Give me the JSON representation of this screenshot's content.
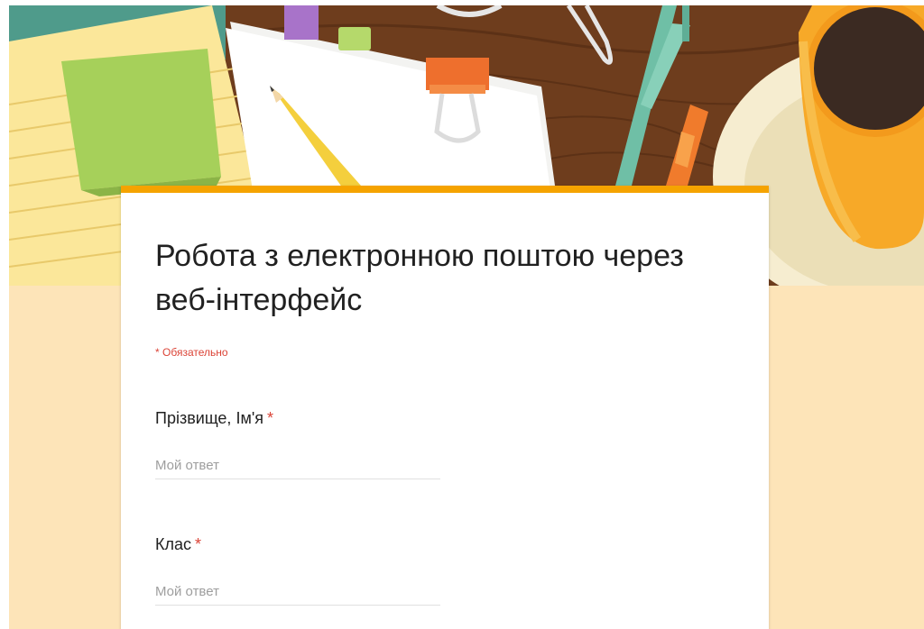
{
  "form": {
    "title": "Робота з електронною поштою через веб-інтерфейс",
    "required_note": "* Обязательно",
    "required_marker": "*",
    "accent_color": "#f5a300",
    "background_color": "#fde4b8",
    "required_color": "#db4437"
  },
  "questions": [
    {
      "label": "Прізвище, Ім'я",
      "placeholder": "Мой ответ",
      "value": ""
    },
    {
      "label": "Клас",
      "placeholder": "Мой ответ",
      "value": ""
    }
  ],
  "header_image": {
    "theme": "desk-with-stationery",
    "icons": [
      "sticky-notes-icon",
      "paper-clip-icon",
      "binder-clip-icon",
      "pencil-icon",
      "pen-icon",
      "marker-icon",
      "coffee-cup-icon"
    ]
  }
}
